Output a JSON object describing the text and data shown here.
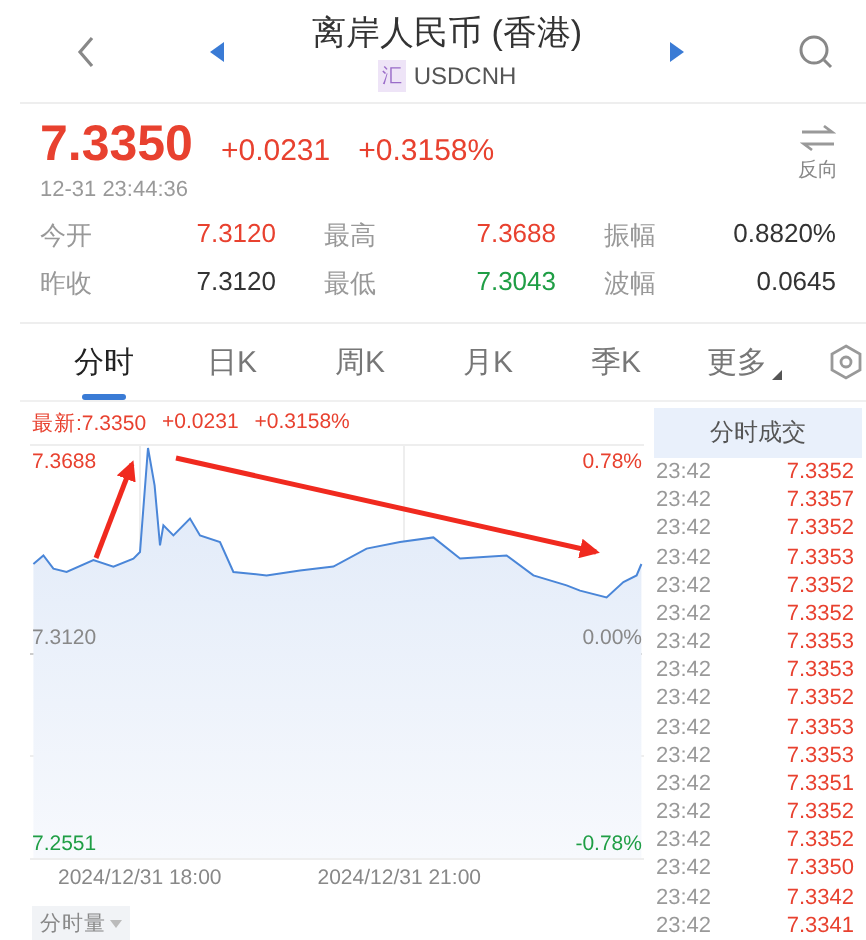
{
  "header": {
    "title": "离岸人民币 (香港)",
    "badge": "汇",
    "symbol": "USDCNH"
  },
  "quote": {
    "price": "7.3350",
    "change": "+0.0231",
    "change_pct": "+0.3158%",
    "timestamp": "12-31 23:44:36",
    "reverse_label": "反向",
    "color": "#e8412f"
  },
  "stats": [
    {
      "label": "今开",
      "value": "7.3120",
      "color": "#e8412f"
    },
    {
      "label": "最高",
      "value": "7.3688",
      "color": "#e8412f"
    },
    {
      "label": "振幅",
      "value": "0.8820%",
      "color": "#333333"
    },
    {
      "label": "昨收",
      "value": "7.3120",
      "color": "#333333"
    },
    {
      "label": "最低",
      "value": "7.3043",
      "color": "#1f9e45"
    },
    {
      "label": "波幅",
      "value": "0.0645",
      "color": "#333333"
    }
  ],
  "tabs": [
    {
      "label": "分时",
      "selected": true,
      "dropdown": false
    },
    {
      "label": "日K",
      "selected": false,
      "dropdown": false
    },
    {
      "label": "周K",
      "selected": false,
      "dropdown": false
    },
    {
      "label": "月K",
      "selected": false,
      "dropdown": false
    },
    {
      "label": "季K",
      "selected": false,
      "dropdown": false
    },
    {
      "label": "更多",
      "selected": false,
      "dropdown": true
    }
  ],
  "chart": {
    "latest": "最新:7.3350",
    "change": "+0.0231",
    "change_pct": "+0.3158%",
    "price_high": "7.3688",
    "pct_high": "0.78%",
    "price_base": "7.3120",
    "pct_base": "0.00%",
    "price_low": "7.2551",
    "pct_low": "-0.78%",
    "time_labels": [
      "2024/12/31 18:00",
      "2024/12/31 21:00"
    ],
    "volume_button": "分时量"
  },
  "trades": {
    "title": "分时成交",
    "rows": [
      {
        "time": "23:42",
        "price": "7.3352"
      },
      {
        "time": "23:42",
        "price": "7.3357"
      },
      {
        "time": "23:42",
        "price": "7.3352"
      },
      {
        "time": "23:42",
        "price": "7.3353"
      },
      {
        "time": "23:42",
        "price": "7.3352"
      },
      {
        "time": "23:42",
        "price": "7.3352"
      },
      {
        "time": "23:42",
        "price": "7.3353"
      },
      {
        "time": "23:42",
        "price": "7.3353"
      },
      {
        "time": "23:42",
        "price": "7.3352"
      },
      {
        "time": "23:42",
        "price": "7.3353"
      },
      {
        "time": "23:42",
        "price": "7.3353"
      },
      {
        "time": "23:42",
        "price": "7.3351"
      },
      {
        "time": "23:42",
        "price": "7.3352"
      },
      {
        "time": "23:42",
        "price": "7.3352"
      },
      {
        "time": "23:42",
        "price": "7.3350"
      },
      {
        "time": "23:42",
        "price": "7.3342"
      },
      {
        "time": "23:42",
        "price": "7.3341"
      }
    ]
  }
}
